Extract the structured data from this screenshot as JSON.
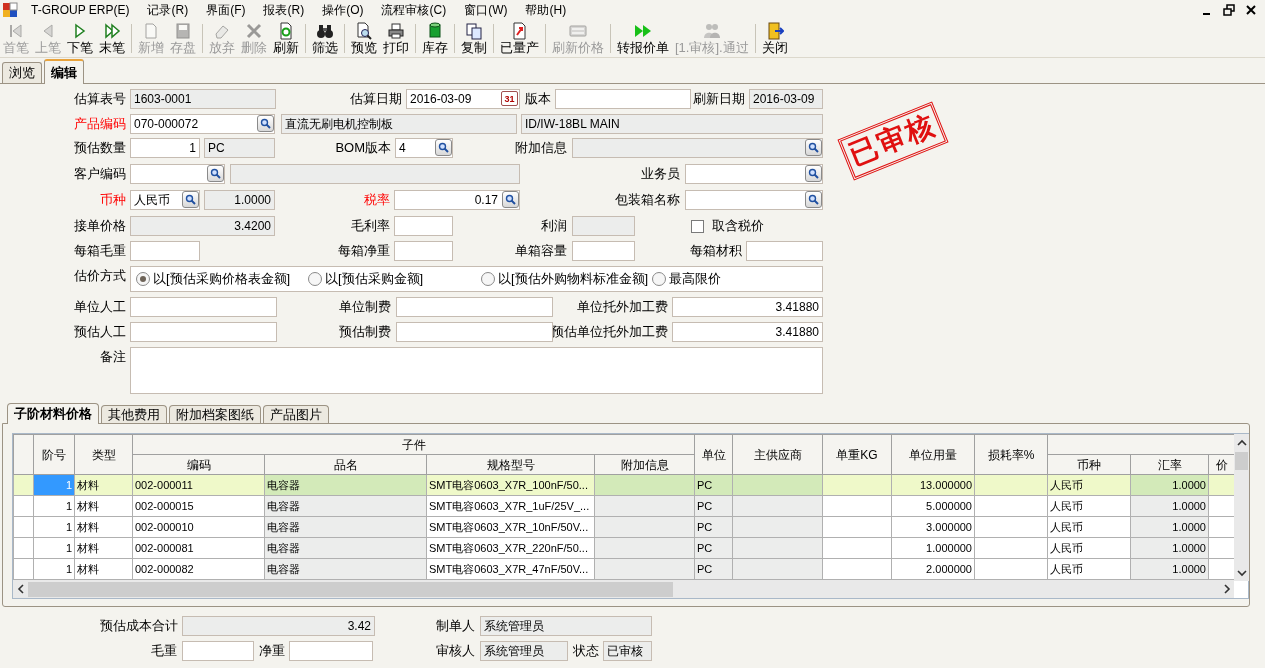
{
  "menu": [
    "T-GROUP ERP(E)",
    "记录(R)",
    "界面(F)",
    "报表(R)",
    "操作(O)",
    "流程审核(C)",
    "窗口(W)",
    "帮助(H)"
  ],
  "toolbar": [
    {
      "label": "首笔",
      "disabled": true
    },
    {
      "label": "上笔",
      "disabled": true
    },
    {
      "label": "下笔",
      "disabled": false
    },
    {
      "label": "末笔",
      "disabled": false
    },
    {
      "label": "新增",
      "disabled": true
    },
    {
      "label": "存盘",
      "disabled": true
    },
    {
      "label": "放弃",
      "disabled": true
    },
    {
      "label": "删除",
      "disabled": true
    },
    {
      "label": "刷新",
      "disabled": false
    },
    {
      "label": "筛选",
      "disabled": false
    },
    {
      "label": "预览",
      "disabled": false
    },
    {
      "label": "打印",
      "disabled": false
    },
    {
      "label": "库存",
      "disabled": false
    },
    {
      "label": "复制",
      "disabled": false
    },
    {
      "label": "已量产",
      "disabled": false
    },
    {
      "label": "刷新价格",
      "disabled": true
    },
    {
      "label": "转报价单",
      "disabled": false
    },
    {
      "label": "[1.审核].通过",
      "disabled": true
    },
    {
      "label": "关闭",
      "disabled": false
    }
  ],
  "tabs": [
    {
      "label": "浏览",
      "selected": false
    },
    {
      "label": "编辑",
      "selected": true
    }
  ],
  "stamp": "已审核",
  "form": {
    "rows": [
      {
        "items": [
          {
            "kind": "label",
            "text": "估算表号",
            "required": false
          },
          {
            "kind": "field",
            "value": "1603-0001",
            "readonly": true
          },
          {
            "kind": "label",
            "text": "估算日期",
            "required": false
          },
          {
            "kind": "field",
            "value": "2016-03-09",
            "readonly": false,
            "button": {
              "kind": "calendar",
              "text": "31"
            }
          },
          {
            "kind": "label",
            "text": "版本",
            "required": false
          },
          {
            "kind": "field",
            "readonly": false
          },
          {
            "kind": "label",
            "text": "刷新日期",
            "required": false
          },
          {
            "kind": "field",
            "value": "2016-03-09",
            "readonly": true
          }
        ]
      },
      {
        "items": [
          {
            "kind": "label",
            "text": "产品编码",
            "required": true
          },
          {
            "kind": "field",
            "value": "070-000072",
            "readonly": false,
            "button": {
              "kind": "lookup"
            }
          },
          {
            "kind": "field",
            "value": "直流无刷电机控制板",
            "readonly": true
          },
          {
            "kind": "field",
            "value": "ID/IW-18BL MAIN",
            "readonly": true
          }
        ]
      },
      {
        "items": [
          {
            "kind": "label",
            "text": "预估数量",
            "required": false
          },
          {
            "kind": "field",
            "value": "1",
            "readonly": false,
            "numeric": true
          },
          {
            "kind": "field",
            "value": "PC",
            "readonly": true
          },
          {
            "kind": "label",
            "text": "BOM版本",
            "required": false
          },
          {
            "kind": "field",
            "value": "4",
            "readonly": false,
            "button": {
              "kind": "lookup"
            }
          },
          {
            "kind": "label",
            "text": "附加信息",
            "required": false
          },
          {
            "kind": "field",
            "readonly": true,
            "button": {
              "kind": "lookup"
            }
          }
        ]
      },
      {
        "items": [
          {
            "kind": "label",
            "text": "客户编码",
            "required": false
          },
          {
            "kind": "field",
            "readonly": false,
            "button": {
              "kind": "lookup"
            }
          },
          {
            "kind": "field",
            "readonly": true
          },
          {
            "kind": "label",
            "text": "业务员",
            "required": false
          },
          {
            "kind": "field",
            "readonly": false,
            "button": {
              "kind": "lookup"
            }
          }
        ]
      },
      {
        "items": [
          {
            "kind": "label",
            "text": "币种",
            "required": true
          },
          {
            "kind": "field",
            "value": "人民币",
            "readonly": false,
            "button": {
              "kind": "lookup"
            }
          },
          {
            "kind": "field",
            "value": "1.0000",
            "readonly": true,
            "numeric": true
          },
          {
            "kind": "label",
            "text": "税率",
            "required": true
          },
          {
            "kind": "field",
            "value": "0.17",
            "readonly": false,
            "numeric": true,
            "button": {
              "kind": "lookup"
            }
          },
          {
            "kind": "label",
            "text": "包装箱名称",
            "required": false
          },
          {
            "kind": "field",
            "readonly": false,
            "button": {
              "kind": "lookup"
            }
          }
        ]
      },
      {
        "items": [
          {
            "kind": "label",
            "text": "接单价格",
            "required": false
          },
          {
            "kind": "field",
            "value": "3.4200",
            "readonly": true,
            "numeric": true
          },
          {
            "kind": "label",
            "text": "毛利率",
            "required": false
          },
          {
            "kind": "field",
            "readonly": false
          },
          {
            "kind": "label",
            "text": "利润",
            "required": false
          },
          {
            "kind": "field",
            "readonly": true
          },
          {
            "kind": "checkbox",
            "label": "取含税价",
            "checked": false
          }
        ]
      },
      {
        "items": [
          {
            "kind": "label",
            "text": "每箱毛重",
            "required": false
          },
          {
            "kind": "field",
            "readonly": false
          },
          {
            "kind": "label",
            "text": "每箱净重",
            "required": false
          },
          {
            "kind": "field",
            "readonly": false
          },
          {
            "kind": "label",
            "text": "单箱容量",
            "required": false
          },
          {
            "kind": "field",
            "readonly": false
          },
          {
            "kind": "label",
            "text": "每箱材积",
            "required": false
          },
          {
            "kind": "field",
            "readonly": false
          }
        ]
      },
      {
        "items": [
          {
            "kind": "label",
            "text": "估价方式",
            "required": false
          },
          {
            "kind": "radios",
            "options": [
              {
                "label": "以[预估采购价格表金额]",
                "selected": true
              },
              {
                "label": "以[预估采购金额]",
                "selected": false
              },
              {
                "label": "以[预估外购物料标准金额]",
                "selected": false
              },
              {
                "label": "最高限价",
                "selected": false
              }
            ]
          }
        ]
      },
      {
        "items": [
          {
            "kind": "label",
            "text": "单位人工",
            "required": false
          },
          {
            "kind": "field",
            "readonly": false
          },
          {
            "kind": "label",
            "text": "单位制费",
            "required": false
          },
          {
            "kind": "field",
            "readonly": false
          },
          {
            "kind": "label",
            "text": "单位托外加工费",
            "required": false
          },
          {
            "kind": "field",
            "value": "3.41880",
            "readonly": false,
            "numeric": true
          }
        ]
      },
      {
        "items": [
          {
            "kind": "label",
            "text": "预估人工",
            "required": false
          },
          {
            "kind": "field",
            "readonly": false
          },
          {
            "kind": "label",
            "text": "预估制费",
            "required": false
          },
          {
            "kind": "field",
            "readonly": false
          },
          {
            "kind": "label",
            "text": "预估单位托外加工费",
            "required": false
          },
          {
            "kind": "field",
            "value": "3.41880",
            "readonly": false,
            "numeric": true
          }
        ]
      },
      {
        "items": [
          {
            "kind": "label",
            "text": "备注",
            "required": false
          },
          {
            "kind": "memo"
          }
        ]
      }
    ]
  },
  "detail_tabs": [
    {
      "label": "子阶材料价格",
      "selected": true
    },
    {
      "label": "其他费用",
      "selected": false
    },
    {
      "label": "附加档案图纸",
      "selected": false
    },
    {
      "label": "产品图片",
      "selected": false
    }
  ],
  "grid": {
    "group_label": "子件",
    "columns": [
      "阶号",
      "类型",
      "编码",
      "品名",
      "规格型号",
      "附加信息",
      "单位",
      "主供应商",
      "单重KG",
      "单位用量",
      "损耗率%",
      "币种",
      "汇率",
      "价"
    ],
    "rows": [
      {
        "level": "1",
        "type": "材料",
        "code": "002-000011",
        "name": "电容器",
        "spec": "SMT电容0603_X7R_100nF/50...",
        "unit": "PC",
        "qty": "13.000000",
        "currency": "人民币",
        "rate": "1.0000",
        "selected": true
      },
      {
        "level": "1",
        "type": "材料",
        "code": "002-000015",
        "name": "电容器",
        "spec": "SMT电容0603_X7R_1uF/25V_...",
        "unit": "PC",
        "qty": "5.000000",
        "currency": "人民币",
        "rate": "1.0000",
        "selected": false
      },
      {
        "level": "1",
        "type": "材料",
        "code": "002-000010",
        "name": "电容器",
        "spec": "SMT电容0603_X7R_10nF/50V...",
        "unit": "PC",
        "qty": "3.000000",
        "currency": "人民币",
        "rate": "1.0000",
        "selected": false
      },
      {
        "level": "1",
        "type": "材料",
        "code": "002-000081",
        "name": "电容器",
        "spec": "SMT电容0603_X7R_220nF/50...",
        "unit": "PC",
        "qty": "1.000000",
        "currency": "人民币",
        "rate": "1.0000",
        "selected": false
      },
      {
        "level": "1",
        "type": "材料",
        "code": "002-000082",
        "name": "电容器",
        "spec": "SMT电容0603_X7R_47nF/50V...",
        "unit": "PC",
        "qty": "2.000000",
        "currency": "人民币",
        "rate": "1.0000",
        "selected": false
      }
    ]
  },
  "footer": {
    "rows": [
      {
        "items": [
          {
            "kind": "label",
            "text": "预估成本合计",
            "required": false
          },
          {
            "kind": "field",
            "value": "3.42",
            "readonly": true,
            "numeric": true
          },
          {
            "kind": "label",
            "text": "制单人",
            "required": false
          },
          {
            "kind": "field",
            "value": "系统管理员",
            "readonly": true
          }
        ]
      },
      {
        "items": [
          {
            "kind": "label",
            "text": "毛重",
            "required": false
          },
          {
            "kind": "field",
            "readonly": false
          },
          {
            "kind": "label",
            "text": "净重",
            "required": false
          },
          {
            "kind": "field",
            "readonly": false
          },
          {
            "kind": "label",
            "text": "审核人",
            "required": false
          },
          {
            "kind": "field",
            "value": "系统管理员",
            "readonly": true
          },
          {
            "kind": "label",
            "text": "状态",
            "required": false
          },
          {
            "kind": "field",
            "value": "已审核",
            "readonly": true
          }
        ]
      }
    ]
  }
}
